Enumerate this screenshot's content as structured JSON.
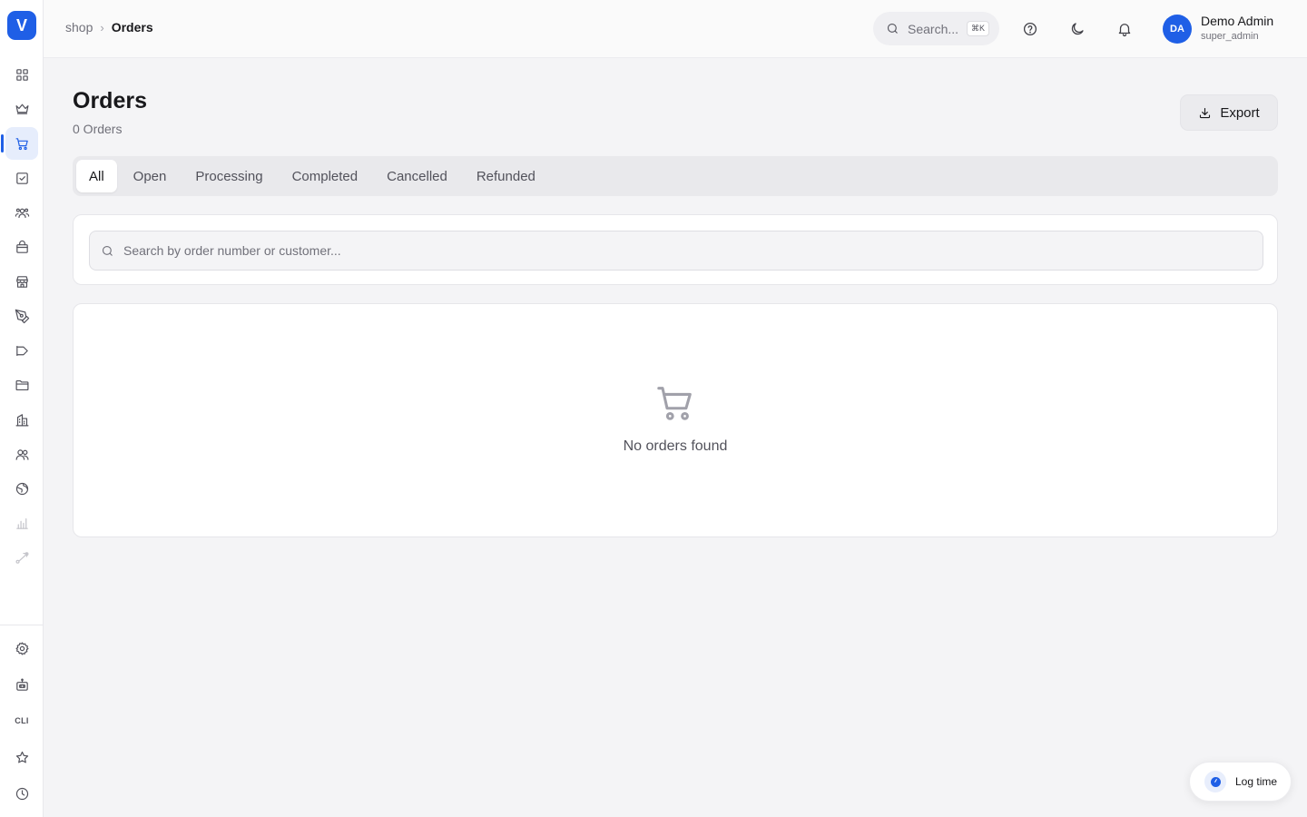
{
  "app": {
    "logo_letter": "V",
    "accent": "#1f5fe6"
  },
  "sidebar": {
    "items": [
      {
        "name": "dashboard",
        "icon": "grid-icon"
      },
      {
        "name": "crown",
        "icon": "crown-icon"
      },
      {
        "name": "orders",
        "icon": "cart-icon",
        "active": true
      },
      {
        "name": "tasks",
        "icon": "check-square-icon"
      },
      {
        "name": "team",
        "icon": "users-icon"
      },
      {
        "name": "products",
        "icon": "shopping-bag-icon"
      },
      {
        "name": "store",
        "icon": "store-icon"
      },
      {
        "name": "design",
        "icon": "pen-tool-icon"
      },
      {
        "name": "campaigns",
        "icon": "megaphone-icon"
      },
      {
        "name": "files",
        "icon": "folder-icon"
      },
      {
        "name": "buildings",
        "icon": "building-icon"
      },
      {
        "name": "customers",
        "icon": "user-group-icon"
      },
      {
        "name": "globe",
        "icon": "globe-icon"
      },
      {
        "name": "analytics",
        "icon": "bar-chart-icon"
      },
      {
        "name": "integrations",
        "icon": "route-icon"
      }
    ],
    "bottom": [
      {
        "name": "settings",
        "icon": "gear-icon"
      },
      {
        "name": "bot",
        "icon": "bot-icon"
      },
      {
        "name": "cli",
        "label": "CLI"
      },
      {
        "name": "favorites",
        "icon": "star-icon"
      },
      {
        "name": "history",
        "icon": "clock-icon"
      }
    ]
  },
  "header": {
    "breadcrumb": {
      "root": "shop",
      "current": "Orders"
    },
    "search": {
      "placeholder": "Search...",
      "shortcut": "⌘K"
    },
    "user": {
      "initials": "DA",
      "name": "Demo Admin",
      "role": "super_admin"
    }
  },
  "main": {
    "title": "Orders",
    "count_label": "0 Orders",
    "export_label": "Export",
    "tabs": [
      {
        "label": "All",
        "active": true
      },
      {
        "label": "Open"
      },
      {
        "label": "Processing"
      },
      {
        "label": "Completed"
      },
      {
        "label": "Cancelled"
      },
      {
        "label": "Refunded"
      }
    ],
    "search_placeholder": "Search by order number or customer...",
    "empty_text": "No orders found"
  },
  "log_time": {
    "label": "Log time"
  }
}
